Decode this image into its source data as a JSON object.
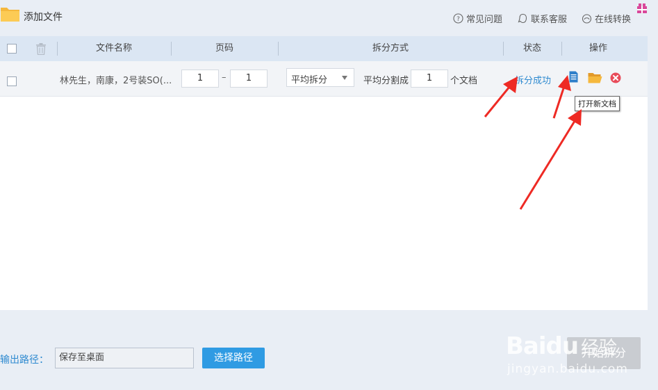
{
  "toolbar": {
    "add_file": "添加文件",
    "faq": "常见问题",
    "contact": "联系客服",
    "online_convert": "在线转换"
  },
  "table": {
    "headers": {
      "filename": "文件名称",
      "page": "页码",
      "split_method": "拆分方式",
      "status": "状态",
      "action": "操作"
    },
    "rows": [
      {
        "filename": "林先生，南康，2号装SO(...",
        "page_from": "1",
        "page_dash": "–",
        "page_to": "1",
        "split_mode": "平均拆分",
        "split_label": "平均分割成",
        "split_count": "1",
        "split_unit": "个文档",
        "status": "拆分成功"
      }
    ]
  },
  "tooltip": "打开新文档",
  "output": {
    "label": "输出路径：",
    "value": "保存至桌面",
    "choose_button": "选择路径",
    "start_button": "开始拆分"
  },
  "watermark": {
    "logo": "Baidu",
    "text": "经验",
    "url": "jingyan.baidu.com"
  },
  "colors": {
    "accent": "#2f9be3",
    "status": "#2e8ad0",
    "delete": "#e84c5a",
    "folder": "#f5b83d",
    "arrow": "#ee2a24"
  },
  "icons": {
    "folder": "folder-icon",
    "trash": "trash-icon",
    "doc": "document-icon",
    "open_folder": "open-folder-icon",
    "delete": "delete-icon",
    "help": "help-icon",
    "chat": "chat-icon",
    "online": "online-icon",
    "gift": "gift-icon"
  }
}
